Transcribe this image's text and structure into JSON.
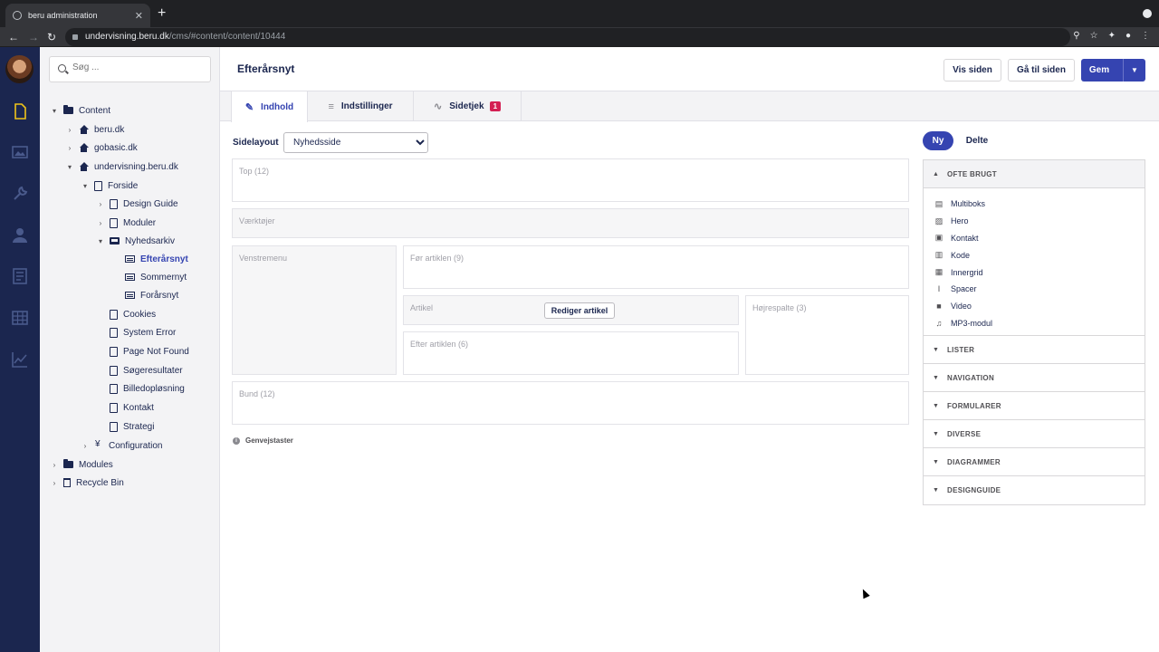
{
  "browser": {
    "tab_title": "beru administration",
    "tab_close": "✕",
    "new_tab": "+",
    "url_host": "undervisning.beru.dk",
    "url_path": "/cms/#content/content/10444"
  },
  "tree": {
    "search_placeholder": "Søg ...",
    "items": [
      {
        "label": "Content",
        "icon": "folder-icon"
      },
      {
        "label": "beru.dk",
        "icon": "house-icon"
      },
      {
        "label": "gobasic.dk",
        "icon": "house-icon"
      },
      {
        "label": "undervisning.beru.dk",
        "icon": "house-icon"
      },
      {
        "label": "Forside",
        "icon": "page-icon"
      },
      {
        "label": "Design Guide",
        "icon": "page-icon"
      },
      {
        "label": "Moduler",
        "icon": "page-icon"
      },
      {
        "label": "Nyhedsarkiv",
        "icon": "inbox-icon"
      },
      {
        "label": "Efterårsnyt",
        "icon": "news-icon"
      },
      {
        "label": "Sommernyt",
        "icon": "news-icon"
      },
      {
        "label": "Forårsnyt",
        "icon": "news-icon"
      },
      {
        "label": "Cookies",
        "icon": "page-icon"
      },
      {
        "label": "System Error",
        "icon": "page-icon"
      },
      {
        "label": "Page Not Found",
        "icon": "page-icon"
      },
      {
        "label": "Søgeresultater",
        "icon": "page-icon"
      },
      {
        "label": "Billedopløsning",
        "icon": "page-icon"
      },
      {
        "label": "Kontakt",
        "icon": "page-icon"
      },
      {
        "label": "Strategi",
        "icon": "page-icon"
      },
      {
        "label": "Configuration",
        "icon": "cog-icon"
      },
      {
        "label": "Modules",
        "icon": "folder-icon"
      },
      {
        "label": "Recycle Bin",
        "icon": "trash-icon"
      }
    ]
  },
  "header": {
    "title": "Efterårsnyt",
    "view_page": "Vis siden",
    "goto_page": "Gå til siden",
    "save": "Gem"
  },
  "tabs": {
    "content": "Indhold",
    "settings": "Indstillinger",
    "page_check": "Sidetjek",
    "page_check_badge": "1"
  },
  "layout": {
    "label": "Sidelayout",
    "selected": "Nyhedsside",
    "areas": {
      "top": "Top (12)",
      "tools": "Værktøjer",
      "left_menu": "Venstremenu",
      "before_article": "Før artiklen (9)",
      "article": "Artikel",
      "edit_article": "Rediger artikel",
      "after_article": "Efter artiklen (6)",
      "right_column": "Højrespalte (3)",
      "bottom": "Bund (12)"
    },
    "shortcuts": "Genvejstaster"
  },
  "panel": {
    "new": "Ny",
    "shared": "Delte",
    "open_section": "OFTE BRUGT",
    "blocks": [
      {
        "label": "Multiboks",
        "icon": "document-icon",
        "glyph": "▤"
      },
      {
        "label": "Hero",
        "icon": "image-icon",
        "glyph": "▨"
      },
      {
        "label": "Kontakt",
        "icon": "contact-card-icon",
        "glyph": "▣"
      },
      {
        "label": "Kode",
        "icon": "code-file-icon",
        "glyph": "▥"
      },
      {
        "label": "Innergrid",
        "icon": "grid-icon",
        "glyph": "▦"
      },
      {
        "label": "Spacer",
        "icon": "spacer-icon",
        "glyph": "I"
      },
      {
        "label": "Video",
        "icon": "video-icon",
        "glyph": "■"
      },
      {
        "label": "MP3-modul",
        "icon": "music-icon",
        "glyph": "♫"
      }
    ],
    "sections": [
      "LISTER",
      "NAVIGATION",
      "FORMULARER",
      "DIVERSE",
      "DIAGRAMMER",
      "DESIGNGUIDE"
    ]
  },
  "colors": {
    "navy": "#1b264f",
    "accent": "#3544b1",
    "badge_red": "#d42054"
  }
}
